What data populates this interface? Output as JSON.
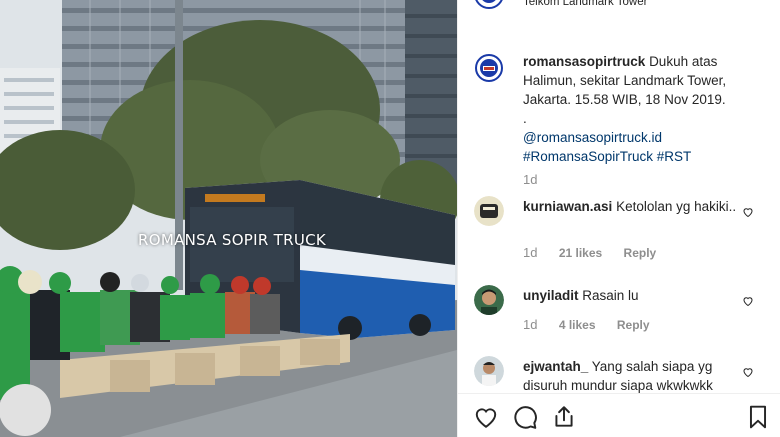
{
  "media": {
    "watermark": "ROMANSA SOPIR TRUCK"
  },
  "post": {
    "location": "Telkom Landmark Tower",
    "caption": {
      "username": "romansasopirtruck",
      "text": "Dukuh atas Halimun, sekitar Landmark Tower, Jakarta. 15.58 WIB, 18 Nov 2019.",
      "dot": ".",
      "mention": "@romansasopirtruck.id",
      "hashtags": "#RomansaSopirTruck #RST",
      "age": "1d"
    },
    "comments": [
      {
        "username": "kurniawan.asi",
        "text": "Ketololan yg hakiki..",
        "age": "1d",
        "likes": "21 likes",
        "reply": "Reply"
      },
      {
        "username": "unyiladit",
        "text": "Rasain lu",
        "age": "1d",
        "likes": "4 likes",
        "reply": "Reply"
      },
      {
        "username": "ejwantah_",
        "text": "Yang salah siapa yg disuruh mundur siapa wkwkwkk",
        "age": "",
        "likes": "",
        "reply": ""
      }
    ]
  },
  "colors": {
    "text": "#262626",
    "secondary": "#8e8e8e",
    "link": "#00376b",
    "border": "#efefef"
  }
}
